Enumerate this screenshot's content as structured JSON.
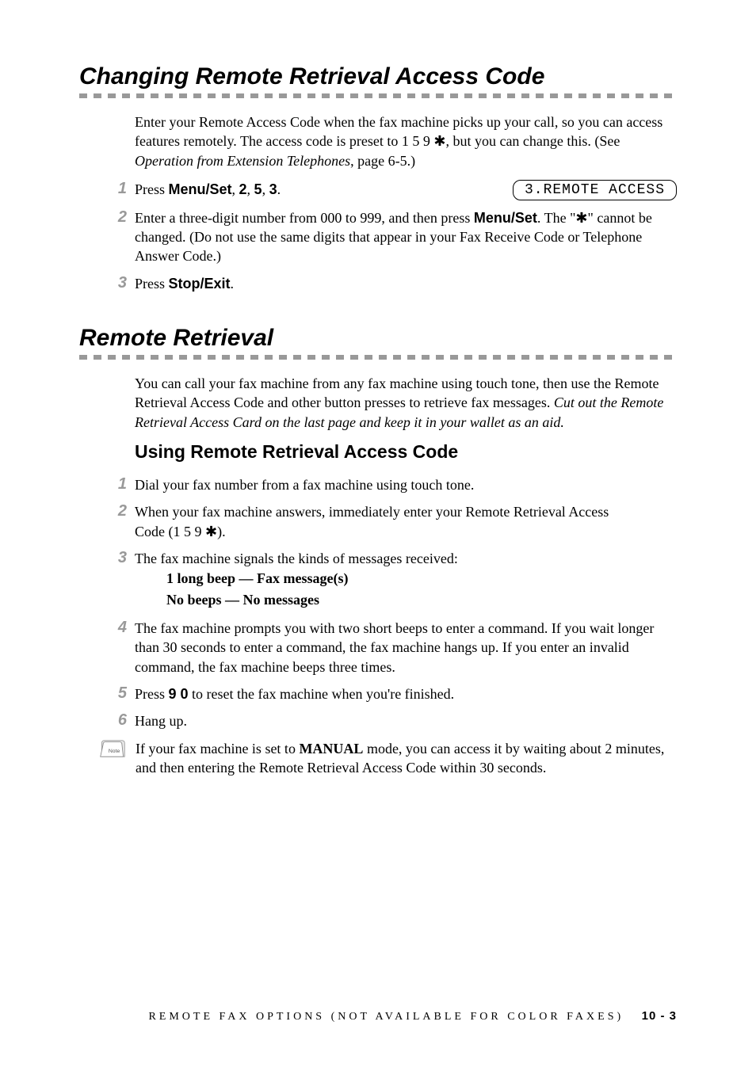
{
  "section1": {
    "title": "Changing Remote Retrieval Access Code",
    "intro_part1": "Enter your Remote Access Code when the fax machine picks up your call, so you can access features remotely.  The access code is preset to 1 5 9 ",
    "intro_star": "✱",
    "intro_part2": ", but you can change this. (See ",
    "intro_italic": "Operation from Extension Telephones",
    "intro_part3": ", page 6-5.)",
    "steps": [
      {
        "num": "1",
        "pre": "Press ",
        "bold": "Menu/Set",
        "mid1": ", ",
        "b2": "2",
        "mid2": ", ",
        "b3": "5",
        "mid3": ", ",
        "b4": "3",
        "post": ".",
        "lcd": "3.REMOTE ACCESS"
      },
      {
        "num": "2",
        "pre": "Enter a three-digit number from 000 to 999, and then press ",
        "bold": "Menu/Set",
        "mid": ". The \"",
        "star": "✱",
        "post": "\" cannot be changed.  (Do not use the same digits that appear in your Fax Receive Code or Telephone Answer Code.)"
      },
      {
        "num": "3",
        "pre": "Press ",
        "bold": "Stop/Exit",
        "post": "."
      }
    ]
  },
  "section2": {
    "title": "Remote Retrieval",
    "intro_part1": "You can call your fax machine from any fax machine using touch tone, then use the Remote Retrieval Access Code and other button presses to retrieve fax messages. ",
    "intro_italic": "Cut out the Remote Retrieval Access Card on the last page and keep it in your wallet as an aid.",
    "subsection": "Using Remote Retrieval Access Code",
    "steps": [
      {
        "num": "1",
        "text": "Dial your fax number from a fax machine using touch tone."
      },
      {
        "num": "2",
        "line1": "When your fax machine answers, immediately enter your Remote Retrieval Access",
        "line2_pre": "Code (1 5 9 ",
        "star": "✱",
        "line2_post": ")."
      },
      {
        "num": "3",
        "text": "The fax machine signals the kinds of messages received:",
        "beep1": "1 long beep — Fax message(s)",
        "beep2": "No beeps — No messages"
      },
      {
        "num": "4",
        "text": "The fax machine prompts you with two short beeps to enter a command.  If you wait longer than 30 seconds to enter a command, the fax machine hangs up.  If you enter an invalid command, the fax machine beeps three times."
      },
      {
        "num": "5",
        "pre": "Press ",
        "bold": "9 0",
        "post": " to reset the fax machine when you're finished."
      },
      {
        "num": "6",
        "text": "Hang up."
      }
    ],
    "note_pre": "If your fax machine is set to ",
    "note_bold": "MANUAL",
    "note_post": " mode, you can access it by waiting about 2 minutes, and then entering the Remote Retrieval Access Code within 30 seconds."
  },
  "footer": {
    "text": "REMOTE FAX OPTIONS (NOT AVAILABLE FOR COLOR FAXES)",
    "page": "10 - 3"
  }
}
